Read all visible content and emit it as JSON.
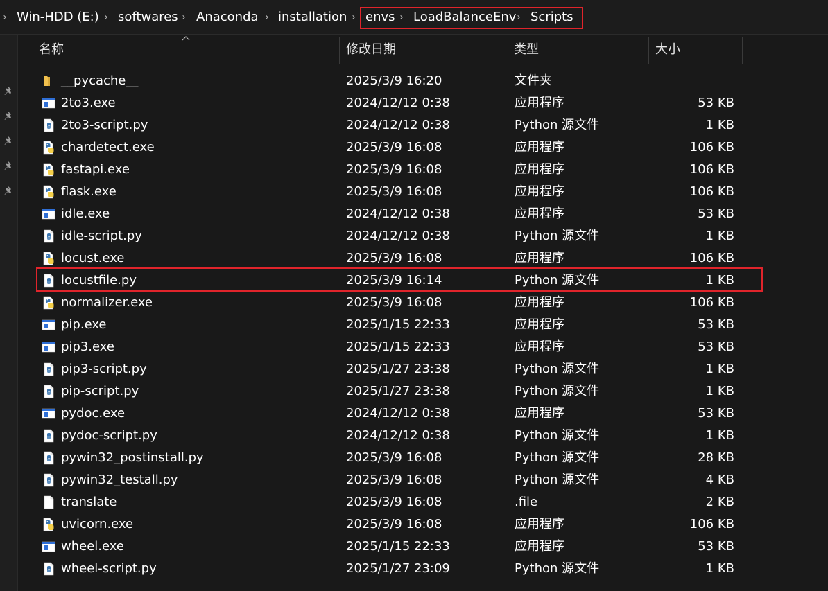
{
  "breadcrumb": {
    "items": [
      "Win-HDD (E:)",
      "softwares",
      "Anaconda",
      "installation",
      "envs",
      "LoadBalanceEnv",
      "Scripts"
    ],
    "highlighted_items": [
      "envs",
      "LoadBalanceEnv",
      "Scripts"
    ]
  },
  "columns": {
    "name": "名称",
    "date": "修改日期",
    "type": "类型",
    "size": "大小"
  },
  "files": [
    {
      "name": "__pycache__",
      "date": "2025/3/9 16:20",
      "type": "文件夹",
      "size": "",
      "icon": "folder-icon"
    },
    {
      "name": "2to3.exe",
      "date": "2024/12/12 0:38",
      "type": "应用程序",
      "size": "53 KB",
      "icon": "exe-window-icon"
    },
    {
      "name": "2to3-script.py",
      "date": "2024/12/12 0:38",
      "type": "Python 源文件",
      "size": "1 KB",
      "icon": "python-file-icon"
    },
    {
      "name": "chardetect.exe",
      "date": "2025/3/9 16:08",
      "type": "应用程序",
      "size": "106 KB",
      "icon": "python-exe-icon"
    },
    {
      "name": "fastapi.exe",
      "date": "2025/3/9 16:08",
      "type": "应用程序",
      "size": "106 KB",
      "icon": "python-exe-icon"
    },
    {
      "name": "flask.exe",
      "date": "2025/3/9 16:08",
      "type": "应用程序",
      "size": "106 KB",
      "icon": "python-exe-icon"
    },
    {
      "name": "idle.exe",
      "date": "2024/12/12 0:38",
      "type": "应用程序",
      "size": "53 KB",
      "icon": "exe-window-icon"
    },
    {
      "name": "idle-script.py",
      "date": "2024/12/12 0:38",
      "type": "Python 源文件",
      "size": "1 KB",
      "icon": "python-file-icon"
    },
    {
      "name": "locust.exe",
      "date": "2025/3/9 16:08",
      "type": "应用程序",
      "size": "106 KB",
      "icon": "python-exe-icon"
    },
    {
      "name": "locustfile.py",
      "date": "2025/3/9 16:14",
      "type": "Python 源文件",
      "size": "1 KB",
      "icon": "python-file-icon"
    },
    {
      "name": "normalizer.exe",
      "date": "2025/3/9 16:08",
      "type": "应用程序",
      "size": "106 KB",
      "icon": "python-exe-icon"
    },
    {
      "name": "pip.exe",
      "date": "2025/1/15 22:33",
      "type": "应用程序",
      "size": "53 KB",
      "icon": "exe-window-icon"
    },
    {
      "name": "pip3.exe",
      "date": "2025/1/15 22:33",
      "type": "应用程序",
      "size": "53 KB",
      "icon": "exe-window-icon"
    },
    {
      "name": "pip3-script.py",
      "date": "2025/1/27 23:38",
      "type": "Python 源文件",
      "size": "1 KB",
      "icon": "python-file-icon"
    },
    {
      "name": "pip-script.py",
      "date": "2025/1/27 23:38",
      "type": "Python 源文件",
      "size": "1 KB",
      "icon": "python-file-icon"
    },
    {
      "name": "pydoc.exe",
      "date": "2024/12/12 0:38",
      "type": "应用程序",
      "size": "53 KB",
      "icon": "exe-window-icon"
    },
    {
      "name": "pydoc-script.py",
      "date": "2024/12/12 0:38",
      "type": "Python 源文件",
      "size": "1 KB",
      "icon": "python-file-icon"
    },
    {
      "name": "pywin32_postinstall.py",
      "date": "2025/3/9 16:08",
      "type": "Python 源文件",
      "size": "28 KB",
      "icon": "python-file-icon"
    },
    {
      "name": "pywin32_testall.py",
      "date": "2025/3/9 16:08",
      "type": "Python 源文件",
      "size": "4 KB",
      "icon": "python-file-icon"
    },
    {
      "name": "translate",
      "date": "2025/3/9 16:08",
      "type": ".file",
      "size": "2 KB",
      "icon": "blank-file-icon"
    },
    {
      "name": "uvicorn.exe",
      "date": "2025/3/9 16:08",
      "type": "应用程序",
      "size": "106 KB",
      "icon": "python-exe-icon"
    },
    {
      "name": "wheel.exe",
      "date": "2025/1/15 22:33",
      "type": "应用程序",
      "size": "53 KB",
      "icon": "exe-window-icon"
    },
    {
      "name": "wheel-script.py",
      "date": "2025/1/27 23:09",
      "type": "Python 源文件",
      "size": "1 KB",
      "icon": "python-file-icon"
    }
  ],
  "highlighted_file": "locustfile.py",
  "colors": {
    "background": "#191919",
    "text": "#ffffff",
    "highlight_border": "#e0242b",
    "folder": "#f2c14e",
    "python_blue": "#3a75b0",
    "python_yellow": "#f5d04a",
    "exe_blue": "#2f6fd6"
  }
}
